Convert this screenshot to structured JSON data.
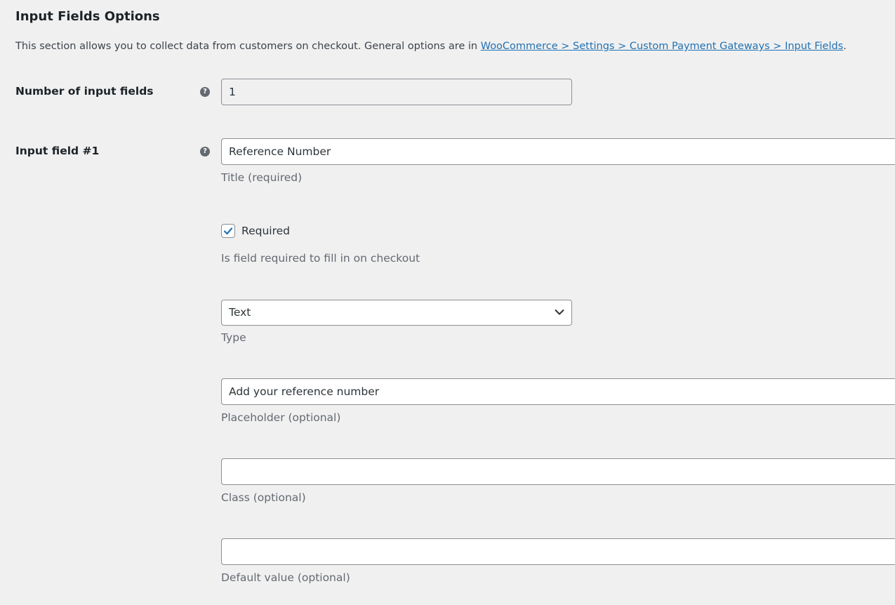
{
  "section": {
    "title": "Input Fields Options",
    "description_prefix": "This section allows you to collect data from customers on checkout. General options are in ",
    "description_link": "WooCommerce > Settings > Custom Payment Gateways > Input Fields",
    "description_suffix": "."
  },
  "number_of_fields": {
    "label": "Number of input fields",
    "value": "1"
  },
  "input_field_1": {
    "label": "Input field #1",
    "title_value": "Reference Number",
    "title_hint": "Title (required)",
    "required_label": "Required",
    "required_checked": true,
    "required_hint": "Is field required to fill in on checkout",
    "type_value": "Text",
    "type_hint": "Type",
    "placeholder_value": "Add your reference number",
    "placeholder_hint": "Placeholder (optional)",
    "class_value": "",
    "class_hint": "Class (optional)",
    "default_value": "",
    "default_hint": "Default value (optional)"
  },
  "icons": {
    "help": "help-tip-icon",
    "check": "checkmark-icon",
    "dropdown": "chevron-down-icon"
  },
  "colors": {
    "link": "#2271b1",
    "check": "#2271b1",
    "help_icon": "#646970",
    "background": "#f0f0f1"
  },
  "help_glyph": "?"
}
